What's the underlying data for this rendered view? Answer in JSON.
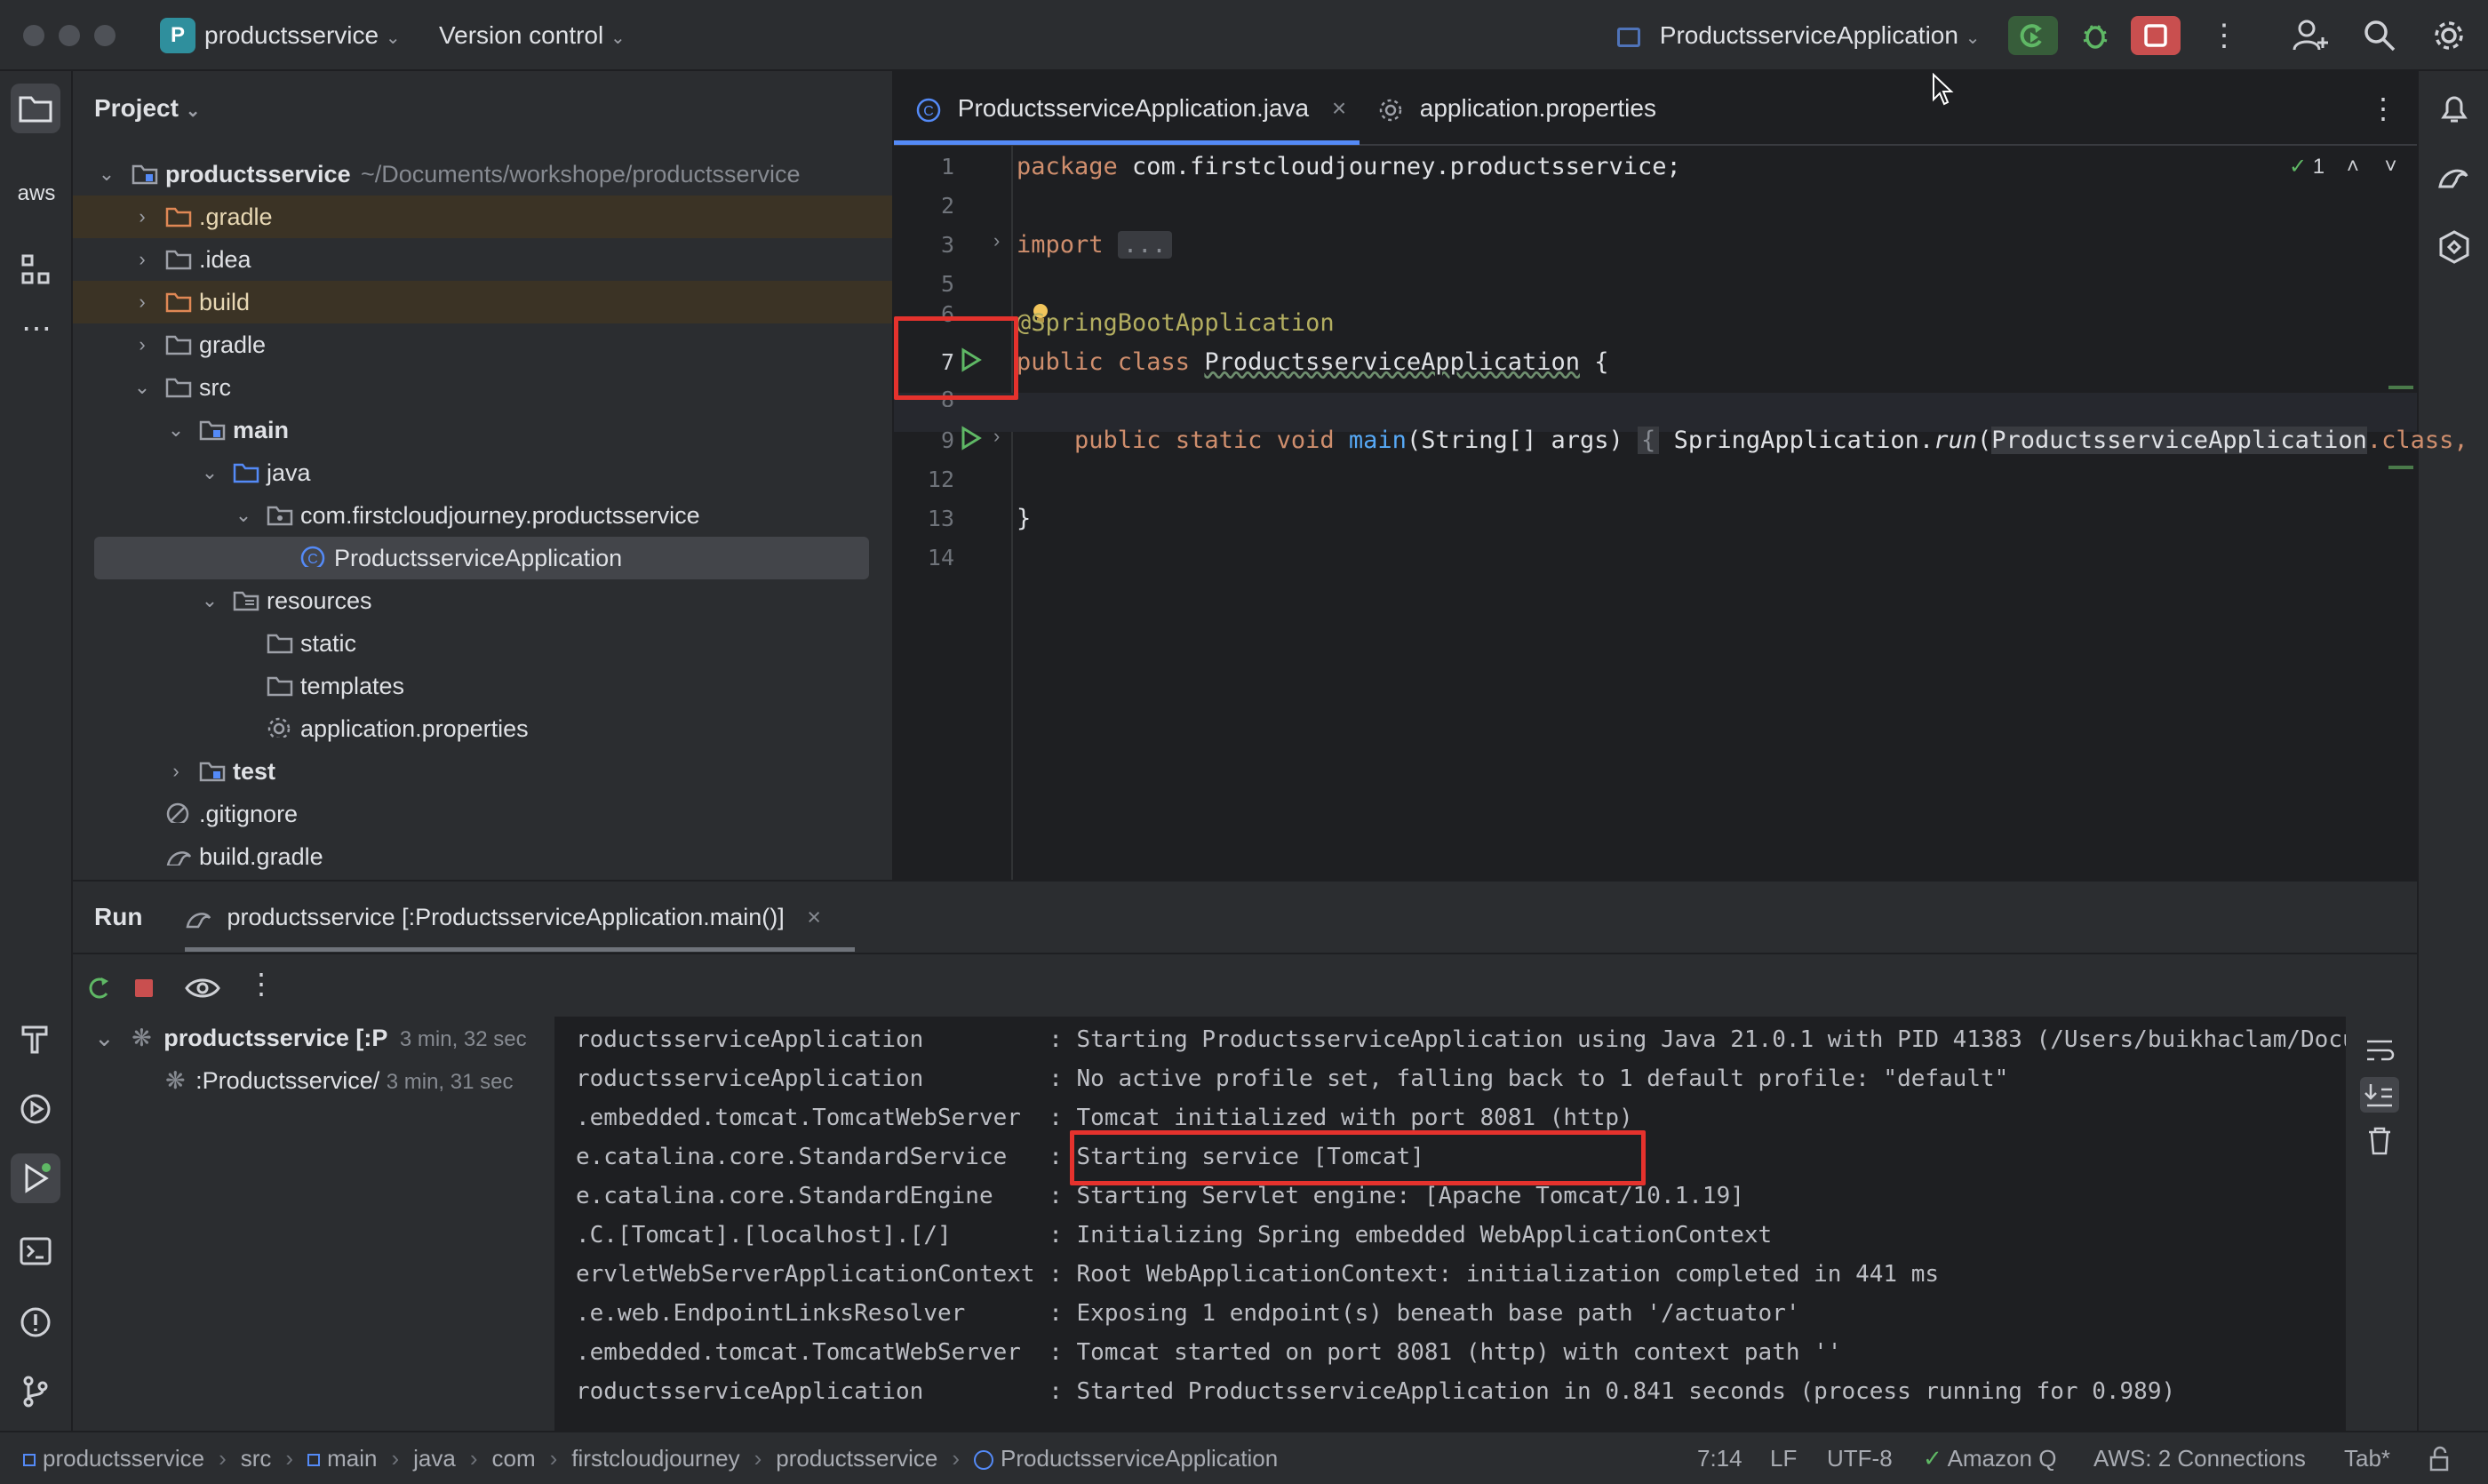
{
  "titlebar": {
    "project_badge": "P",
    "project_name": "productsservice",
    "vcs": "Version control",
    "run_config": "ProductsserviceApplication"
  },
  "left_stripe": [
    "project-icon",
    "aws-icon",
    "structure-icon",
    "more-icon",
    "build-icon",
    "services-icon",
    "run-icon",
    "terminal-icon",
    "problems-icon",
    "git-icon"
  ],
  "left_stripe_aws": "aws",
  "project_panel": {
    "title": "Project",
    "root_name": "productsservice",
    "root_path": "~/Documents/workshope/productsservice",
    "items": [
      {
        "label": ".gradle"
      },
      {
        "label": ".idea"
      },
      {
        "label": "build"
      },
      {
        "label": "gradle"
      },
      {
        "label": "src"
      },
      {
        "label": "main"
      },
      {
        "label": "java"
      },
      {
        "label": "com.firstcloudjourney.productsservice"
      },
      {
        "label": "ProductsserviceApplication"
      },
      {
        "label": "resources"
      },
      {
        "label": "static"
      },
      {
        "label": "templates"
      },
      {
        "label": "application.properties"
      },
      {
        "label": "test"
      },
      {
        "label": ".gitignore"
      },
      {
        "label": "build.gradle"
      }
    ]
  },
  "editor": {
    "tabs": [
      {
        "label": "ProductsserviceApplication.java",
        "active": true
      },
      {
        "label": "application.properties",
        "active": false
      }
    ],
    "inspection_count": "1",
    "line_numbers": [
      "1",
      "2",
      "3",
      "5",
      "6",
      "7",
      "8",
      "9",
      "12",
      "13",
      "14"
    ],
    "code": {
      "l1_kw": "package",
      "l1_rest": " com.firstcloudjourney.productsservice;",
      "l3_kw": "import",
      "l3_fold": "...",
      "l6_ann": "@SpringBootApplication",
      "l7_kw": "public class",
      "l7_name": "ProductsserviceApplication",
      "l7_brace": " {",
      "l9_kw": "public static void",
      "l9_fn": "main",
      "l9_args": "(String[] args)",
      "l9_fold": "{",
      "l9_body1": "SpringApplication.",
      "l9_run": "run",
      "l9_body2": "(",
      "l9_cls": "ProductsserviceApplication",
      "l9_body3": ".class,",
      "l13": "}"
    }
  },
  "run_panel": {
    "title": "Run",
    "tab_label": "productsservice [:ProductsserviceApplication.main()]",
    "tree": [
      {
        "label": "productsservice [:P",
        "time": "3 min, 32 sec"
      },
      {
        "label": ":Productsservice/",
        "time": "3 min, 31 sec"
      }
    ],
    "console_lines": [
      {
        "src": "roductsserviceApplication        ",
        "msg": ": Starting ProductsserviceApplication using Java 21.0.1 with PID 41383 (/Users/buikhaclam/Docu"
      },
      {
        "src": "roductsserviceApplication        ",
        "msg": ": No active profile set, falling back to 1 default profile: \"default\""
      },
      {
        "src": ".embedded.tomcat.TomcatWebServer  ",
        "msg": ": Tomcat initialized with port 8081 (http)"
      },
      {
        "src": "e.catalina.core.StandardService   ",
        "msg": ": Starting service [Tomcat]"
      },
      {
        "src": "e.catalina.core.StandardEngine    ",
        "msg": ": Starting Servlet engine: [Apache Tomcat/10.1.19]"
      },
      {
        "src": ".C.[Tomcat].[localhost].[/]       ",
        "msg": ": Initializing Spring embedded WebApplicationContext"
      },
      {
        "src": "ervletWebServerApplicationContext ",
        "msg": ": Root WebApplicationContext: initialization completed in 441 ms"
      },
      {
        "src": ".e.web.EndpointLinksResolver      ",
        "msg": ": Exposing 1 endpoint(s) beneath base path '/actuator'"
      },
      {
        "src": ".embedded.tomcat.TomcatWebServer  ",
        "msg": ": Tomcat started on port 8081 (http) with context path ''"
      },
      {
        "src": "roductsserviceApplication        ",
        "msg": ": Started ProductsserviceApplication in 0.841 seconds (process running for 0.989)"
      }
    ]
  },
  "statusbar": {
    "breadcrumbs": [
      "productsservice",
      "src",
      "main",
      "java",
      "com",
      "firstcloudjourney",
      "productsservice",
      "ProductsserviceApplication"
    ],
    "position": "7:14",
    "line_sep": "LF",
    "encoding": "UTF-8",
    "amazon_q": "Amazon Q",
    "aws": "AWS: 2 Connections",
    "indent": "Tab*"
  },
  "colors": {
    "accent_red": "#e5322d",
    "run_green": "#4ca65e",
    "stop_red": "#db5c5c"
  }
}
